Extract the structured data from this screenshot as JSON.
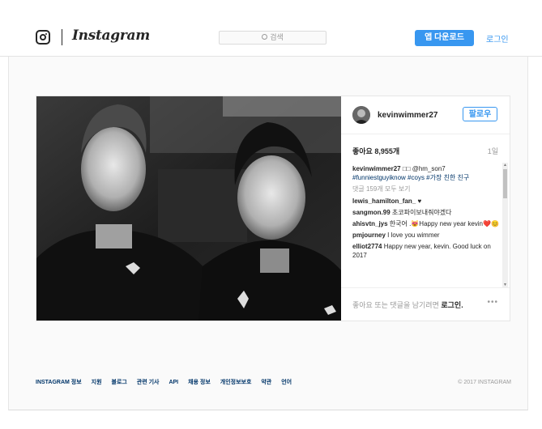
{
  "header": {
    "wordmark": "Instagram",
    "search_placeholder": "검색",
    "app_download": "앱 다운로드",
    "login": "로그인"
  },
  "post": {
    "author": "kevinwimmer27",
    "follow": "팔로우",
    "likes": "좋아요 8,955개",
    "date": "1일",
    "caption_user": "kevinwimmer27",
    "caption_text": " □□ @hm_son7 ",
    "caption_tags": "#funniestguyiknow #coys",
    "caption_tail": " #가장 친한 친구",
    "load_more": "댓글 159개 모두 보기",
    "comments": [
      {
        "user": "lewis_hamilton_fan_",
        "text": " ♥"
      },
      {
        "user": "sangmon.99",
        "text": " 초코파이보내줘야겠다"
      },
      {
        "user": "ahisvtn_jys",
        "text": " 한국어 .😻Happy new year kevin❤️😊"
      },
      {
        "user": "pmjourney",
        "text": " I love you wimmer"
      },
      {
        "user": "elliot2774",
        "text": " Happy new year, kevin. Good luck on 2017"
      }
    ],
    "add_comment_prefix": "좋아요 또는 댓글을 남기려면 ",
    "add_comment_link": "로그인.",
    "more": "•••"
  },
  "footer": {
    "links": [
      "INSTAGRAM 정보",
      "지원",
      "블로그",
      "관련 기사",
      "API",
      "채용 정보",
      "개인정보보호",
      "약관",
      "언어"
    ],
    "copyright": "© 2017 INSTAGRAM"
  },
  "colors": {
    "accent": "#3897f0",
    "hashtag": "#003569"
  }
}
